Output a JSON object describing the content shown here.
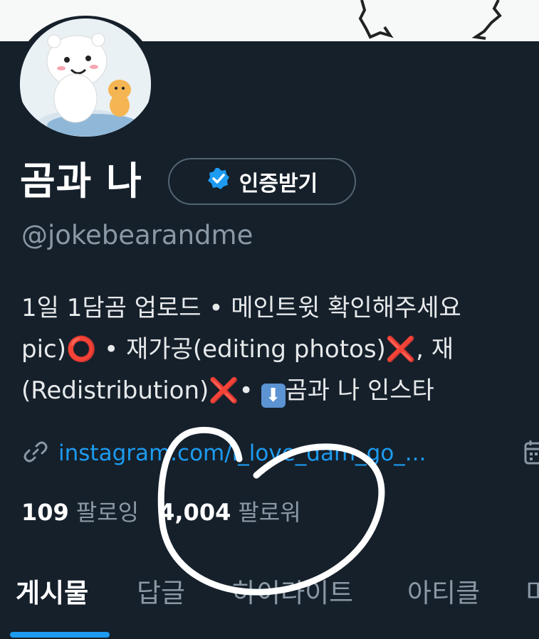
{
  "profile": {
    "name": "곰과 나",
    "verify_button_label": "인증받기",
    "handle": "@jokebearandme",
    "bio_lines": [
      "1일 1담곰 업로드 • 메인트윗 확인해주세요",
      [
        "pic)",
        "⭕",
        " • 재가공(editing photos)",
        "❌",
        ", 재"
      ],
      [
        "(Redistribution)",
        "❌",
        "• ",
        "⬇",
        "곰과 나 인스타"
      ]
    ],
    "link": "instagram.com/i_love_dam_go_..."
  },
  "stats": {
    "following_count": "109",
    "following_label": "팔로잉",
    "followers_count": "4,004",
    "followers_label": "팔로워"
  },
  "tabs": [
    {
      "label": "게시물",
      "active": true
    },
    {
      "label": "답글",
      "active": false
    },
    {
      "label": "하이라이트",
      "active": false
    },
    {
      "label": "아티클",
      "active": false
    },
    {
      "label": "미",
      "active": false
    }
  ],
  "icons": {
    "verified": "verified-badge-icon",
    "link": "link-icon",
    "calendar": "calendar-icon"
  },
  "colors": {
    "background": "#15202b",
    "accent": "#1d9bf0",
    "muted": "#8b98a5"
  }
}
